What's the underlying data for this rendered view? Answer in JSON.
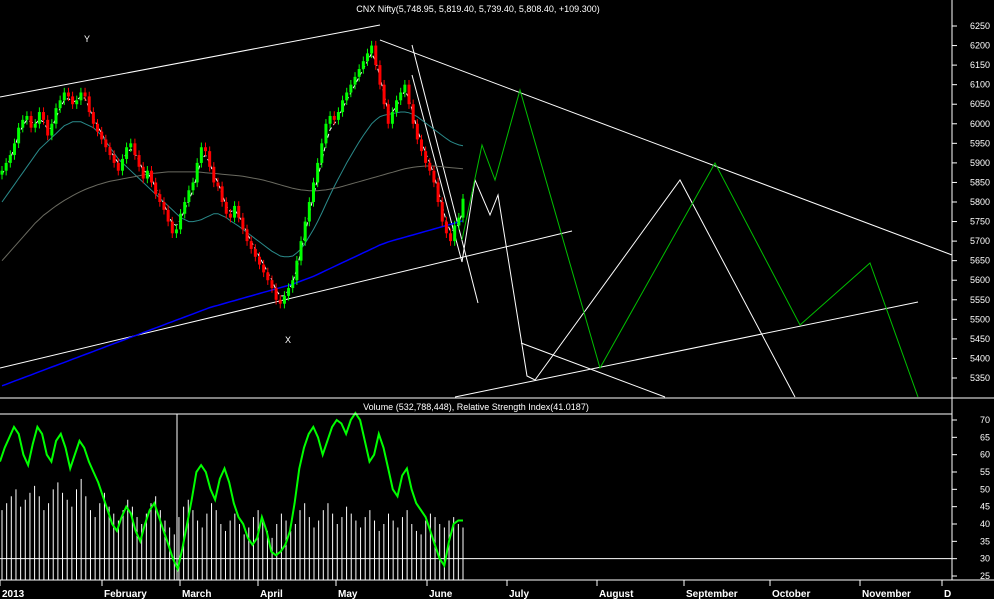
{
  "chart_data": [
    {
      "type": "candlestick",
      "title": "CNX Nifty(5,748.95, 5,819.40, 5,739.40, 5,808.40, +109.300)",
      "quote": {
        "open": 5748.95,
        "high": 5819.4,
        "low": 5739.4,
        "close": 5808.4,
        "change": 109.3
      },
      "ylim": [
        5290,
        6290
      ],
      "y_ticks": [
        5350,
        5400,
        5450,
        5500,
        5550,
        5600,
        5650,
        5700,
        5750,
        5800,
        5850,
        5900,
        5950,
        6000,
        6050,
        6100,
        6150,
        6200,
        6250
      ],
      "x_months": [
        "2013",
        "February",
        "March",
        "April",
        "May",
        "June",
        "July",
        "August",
        "September",
        "October",
        "November",
        "D"
      ],
      "annotations": [
        "Y",
        "X"
      ],
      "series": [
        {
          "name": "",
          "kind": "ohlc",
          "color_up": "#00ff00",
          "color_down": "#ff0000",
          "closes": [
            5880,
            5900,
            5920,
            5950,
            5990,
            6010,
            6020,
            5990,
            6000,
            6030,
            6010,
            5970,
            6000,
            6040,
            6060,
            6080,
            6070,
            6050,
            6060,
            6080,
            6070,
            6030,
            6000,
            5980,
            5960,
            5940,
            5920,
            5900,
            5880,
            5910,
            5940,
            5950,
            5920,
            5890,
            5860,
            5880,
            5850,
            5820,
            5800,
            5780,
            5750,
            5720,
            5730,
            5770,
            5800,
            5830,
            5850,
            5900,
            5940,
            5930,
            5890,
            5850,
            5840,
            5800,
            5770,
            5760,
            5790,
            5760,
            5730,
            5700,
            5680,
            5660,
            5640,
            5620,
            5600,
            5580,
            5550,
            5540,
            5560,
            5580,
            5600,
            5650,
            5700,
            5750,
            5800,
            5850,
            5900,
            5950,
            6000,
            6020,
            6010,
            6030,
            6060,
            6080,
            6100,
            6120,
            6140,
            6160,
            6180,
            6200,
            6150,
            6100,
            6050,
            6000,
            6030,
            6060,
            6080,
            6100,
            6050,
            6000,
            5960,
            5930,
            5900,
            5880,
            5850,
            5800,
            5750,
            5720,
            5700,
            5740,
            5760,
            5808.4
          ]
        },
        {
          "name": "",
          "kind": "moving-average",
          "color": "#ffffff",
          "style": "dashed",
          "values": [
            5870,
            5890,
            5910,
            5940,
            5970,
            5995,
            6010,
            6005,
            6000,
            6010,
            6005,
            5985,
            5990,
            6015,
            6040,
            6060,
            6065,
            6055,
            6060,
            6070,
            6065,
            6040,
            6015,
            5995,
            5975,
            5955,
            5935,
            5915,
            5900,
            5905,
            5925,
            5935,
            5925,
            5905,
            5880,
            5875,
            5860,
            5835,
            5815,
            5795,
            5770,
            5745,
            5740,
            5755,
            5780,
            5805,
            5830,
            5870,
            5910,
            5920,
            5900,
            5870,
            5850,
            5820,
            5790,
            5775,
            5780,
            5765,
            5745,
            5720,
            5700,
            5680,
            5660,
            5640,
            5620,
            5600,
            5575,
            5560,
            5560,
            5575,
            5595,
            5630,
            5675,
            5720,
            5770,
            5815,
            5860,
            5905,
            5950,
            5985,
            6000,
            6015,
            6040,
            6060,
            6080,
            6100,
            6120,
            6140,
            6160,
            6180,
            6160,
            6120,
            6075,
            6030,
            6030,
            6045,
            6065,
            6085,
            6065,
            6025,
            5985,
            5955,
            5925,
            5900,
            5870,
            5830,
            5790,
            5750,
            5725,
            5730,
            5745,
            5780
          ]
        },
        {
          "name": "",
          "kind": "moving-average",
          "color": "#2a8a8a",
          "values": [
            5800,
            5815,
            5830,
            5845,
            5860,
            5875,
            5890,
            5905,
            5920,
            5935,
            5945,
            5955,
            5965,
            5975,
            5985,
            5995,
            6000,
            6005,
            6005,
            6005,
            6000,
            5995,
            5990,
            5980,
            5970,
            5955,
            5940,
            5925,
            5910,
            5900,
            5890,
            5880,
            5870,
            5860,
            5850,
            5840,
            5830,
            5820,
            5810,
            5800,
            5790,
            5780,
            5770,
            5760,
            5755,
            5750,
            5750,
            5752,
            5755,
            5760,
            5765,
            5770,
            5770,
            5765,
            5760,
            5752,
            5745,
            5738,
            5730,
            5722,
            5714,
            5706,
            5698,
            5690,
            5682,
            5674,
            5668,
            5662,
            5660,
            5660,
            5662,
            5670,
            5680,
            5695,
            5712,
            5730,
            5750,
            5772,
            5795,
            5818,
            5840,
            5860,
            5880,
            5900,
            5918,
            5936,
            5954,
            5970,
            5985,
            6000,
            6010,
            6018,
            6022,
            6024,
            6026,
            6028,
            6030,
            6030,
            6028,
            6024,
            6018,
            6010,
            6002,
            5994,
            5986,
            5978,
            5970,
            5962,
            5955,
            5950,
            5946,
            5944
          ]
        },
        {
          "name": "",
          "kind": "moving-average",
          "color": "#6a6a60",
          "values": [
            5650,
            5662,
            5674,
            5686,
            5698,
            5710,
            5722,
            5734,
            5746,
            5756,
            5766,
            5774,
            5782,
            5790,
            5797,
            5804,
            5810,
            5816,
            5822,
            5827,
            5832,
            5836,
            5840,
            5844,
            5847,
            5850,
            5853,
            5855,
            5857,
            5859,
            5861,
            5863,
            5865,
            5867,
            5869,
            5871,
            5873,
            5874,
            5875,
            5876,
            5877,
            5877,
            5877,
            5877,
            5877,
            5877,
            5877,
            5877,
            5876,
            5875,
            5874,
            5873,
            5872,
            5871,
            5870,
            5869,
            5868,
            5867,
            5866,
            5864,
            5862,
            5860,
            5858,
            5856,
            5853,
            5850,
            5847,
            5844,
            5841,
            5838,
            5835,
            5833,
            5831,
            5830,
            5829,
            5829,
            5829,
            5830,
            5831,
            5833,
            5835,
            5837,
            5840,
            5843,
            5846,
            5849,
            5852,
            5855,
            5858,
            5861,
            5864,
            5867,
            5870,
            5873,
            5876,
            5879,
            5882,
            5885,
            5887,
            5889,
            5890,
            5891,
            5892,
            5892,
            5892,
            5891,
            5890,
            5889,
            5888,
            5887,
            5886,
            5885
          ]
        },
        {
          "name": "",
          "kind": "moving-average",
          "color": "#0000ff",
          "values": [
            5330,
            5334,
            5338,
            5342,
            5346,
            5350,
            5354,
            5358,
            5362,
            5366,
            5370,
            5374,
            5378,
            5382,
            5386,
            5390,
            5394,
            5398,
            5402,
            5406,
            5410,
            5414,
            5418,
            5422,
            5426,
            5430,
            5434,
            5438,
            5442,
            5446,
            5450,
            5454,
            5458,
            5462,
            5466,
            5470,
            5474,
            5478,
            5482,
            5486,
            5490,
            5494,
            5498,
            5502,
            5506,
            5510,
            5514,
            5518,
            5522,
            5526,
            5530,
            5533,
            5536,
            5539,
            5542,
            5545,
            5548,
            5551,
            5554,
            5557,
            5560,
            5563,
            5566,
            5569,
            5572,
            5575,
            5578,
            5581,
            5584,
            5587,
            5590,
            5594,
            5598,
            5602,
            5606,
            5610,
            5615,
            5620,
            5625,
            5630,
            5635,
            5640,
            5645,
            5650,
            5655,
            5660,
            5665,
            5670,
            5675,
            5680,
            5685,
            5690,
            5694,
            5698,
            5701,
            5704,
            5707,
            5710,
            5713,
            5716,
            5719,
            5722,
            5725,
            5728,
            5731,
            5734,
            5737,
            5740,
            5743,
            5746,
            5749,
            5752
          ]
        }
      ],
      "trendlines_color": "#ffffff",
      "projection_colors": [
        "#ffffff",
        "#00c000"
      ]
    },
    {
      "type": "line+bar",
      "title": "Volume (532,788,448), Relative Strength Index(41.0187)",
      "volume": 532788448,
      "rsi": 41.0187,
      "ylim": [
        22,
        73
      ],
      "y_ticks": [
        25,
        30,
        35,
        40,
        45,
        50,
        55,
        60,
        65,
        70
      ],
      "reference_level": 30,
      "series": [
        {
          "name": "",
          "kind": "rsi",
          "color": "#00ff00",
          "values": [
            58,
            62,
            65,
            68,
            66,
            60,
            57,
            63,
            68,
            66,
            60,
            58,
            64,
            66,
            62,
            56,
            60,
            64,
            62,
            58,
            55,
            52,
            48,
            44,
            40,
            38,
            42,
            45,
            43,
            38,
            35,
            40,
            44,
            46,
            42,
            38,
            34,
            30,
            27,
            33,
            40,
            47,
            55,
            57,
            55,
            50,
            47,
            53,
            56,
            52,
            46,
            42,
            40,
            36,
            34,
            36,
            42,
            38,
            32,
            31,
            32,
            34,
            38,
            46,
            56,
            62,
            66,
            68,
            65,
            60,
            64,
            68,
            70,
            69,
            66,
            70,
            72,
            70,
            64,
            58,
            60,
            66,
            62,
            56,
            50,
            48,
            54,
            56,
            50,
            46,
            44,
            42,
            38,
            34,
            30,
            28,
            35,
            40,
            41,
            41
          ]
        },
        {
          "name": "",
          "kind": "volume-bars",
          "color": "#ffffff",
          "values": [
            44,
            46,
            48,
            50,
            45,
            47,
            49,
            51,
            48,
            44,
            46,
            50,
            52,
            49,
            47,
            45,
            50,
            53,
            48,
            44,
            42,
            46,
            49,
            45,
            43,
            41,
            44,
            47,
            45,
            42,
            40,
            43,
            46,
            48,
            44,
            41,
            39,
            37,
            42,
            45,
            47,
            44,
            41,
            39,
            43,
            46,
            44,
            40,
            38,
            41,
            43,
            40,
            37,
            39,
            42,
            44,
            41,
            38,
            36,
            40,
            43,
            41,
            38,
            40,
            44,
            46,
            42,
            39,
            41,
            44,
            46,
            43,
            40,
            42,
            45,
            43,
            41,
            39,
            42,
            44,
            41,
            38,
            40,
            43,
            41,
            39,
            42,
            44,
            40,
            38,
            37,
            41,
            43,
            42,
            40,
            39,
            41,
            42,
            40,
            39
          ]
        }
      ]
    }
  ]
}
